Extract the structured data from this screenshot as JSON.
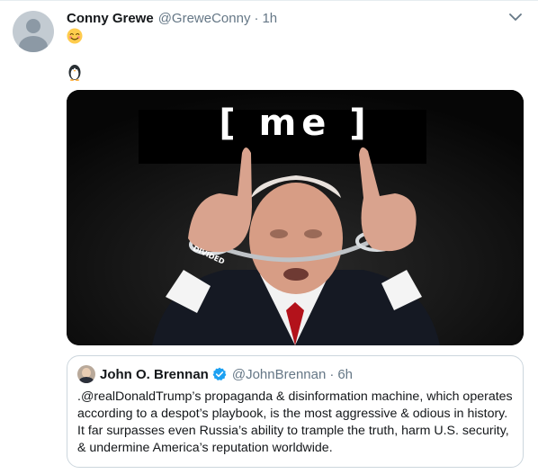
{
  "tweet": {
    "author": {
      "display_name": "Conny Grewe",
      "handle": "@GreweConny",
      "time": "1h"
    },
    "separator": "·",
    "emoji_line_1": "smiling-face-emoji",
    "emoji_line_2": "penguin-emoji",
    "media": {
      "caption_text": "[ me ]"
    },
    "menu_icon": "chevron-down-icon"
  },
  "quoted_tweet": {
    "author": {
      "display_name": "John O. Brennan",
      "handle": "@JohnBrennan",
      "time": "6h",
      "verified": true
    },
    "separator": "·",
    "text": ".@realDonaldTrump’s propaganda & disinformation machine, which operates according to a despot’s playbook, is the most aggressive & odious in history. It far surpasses even Russia’s ability to trample the truth, harm U.S. security, & undermine America’s reputation worldwide."
  },
  "colors": {
    "text_primary": "#14171a",
    "text_secondary": "#657786",
    "border": "#ccd6dd",
    "verified_blue": "#1da1f2"
  }
}
